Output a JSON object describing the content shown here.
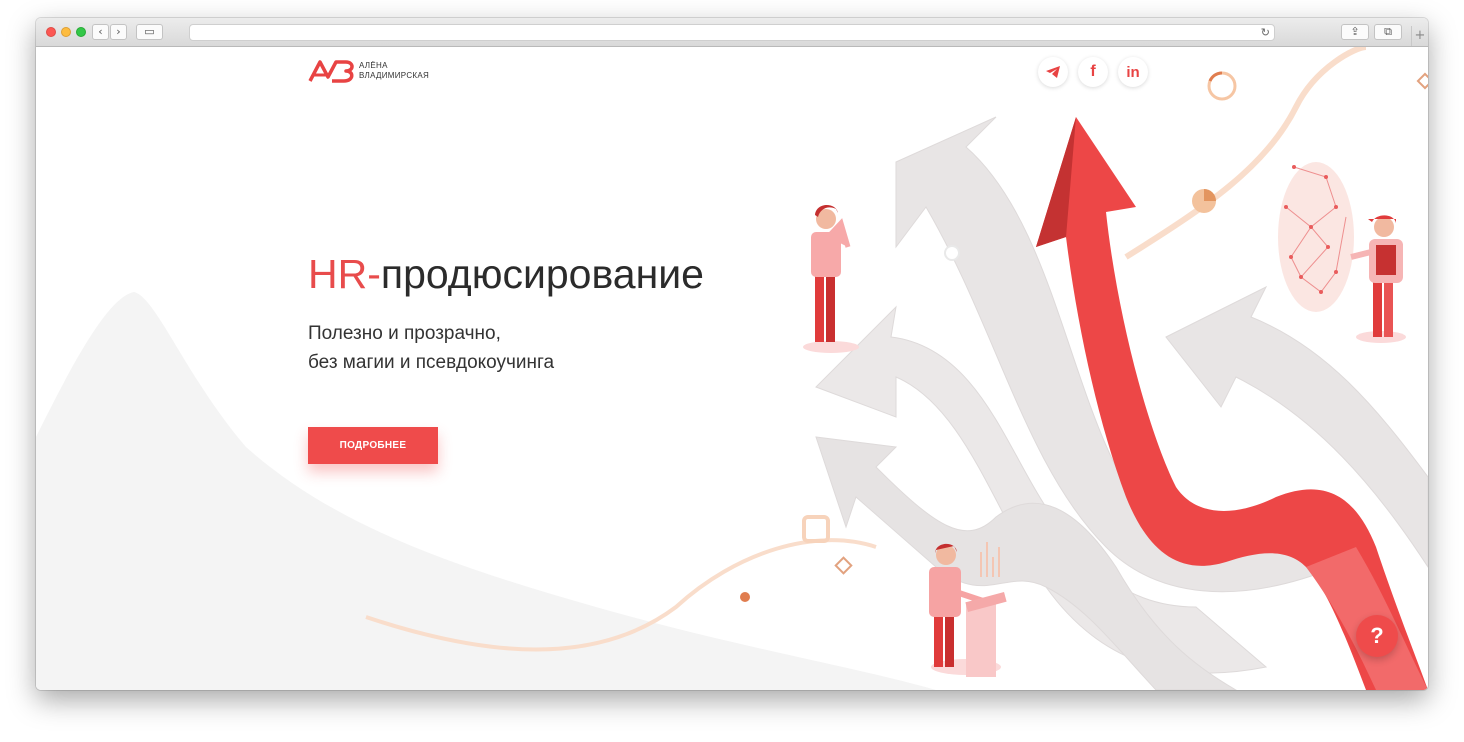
{
  "browser": {
    "back_label": "‹",
    "forward_label": "›",
    "sidebar_label": "▭",
    "share_label": "⇪",
    "tabs_label": "⧉",
    "reload_label": "↻",
    "new_tab_label": "+"
  },
  "site": {
    "logo_first_name": "АЛЁНА",
    "logo_last_name": "ВЛАДИМИРСКАЯ",
    "logo_monogram": "AB"
  },
  "social": [
    {
      "icon": "telegram-icon",
      "label": "➤"
    },
    {
      "icon": "facebook-icon",
      "label": "f"
    },
    {
      "icon": "linkedin-icon",
      "label": "in"
    }
  ],
  "hero": {
    "title_accent": "HR-",
    "title_rest": "продюсирование",
    "subtitle_line1": "Полезно и прозрачно,",
    "subtitle_line2": "без магии и псевдокоучинга",
    "button_label": "ПОДРОБНЕЕ"
  },
  "help_label": "?",
  "colors": {
    "accent": "#ef4b4b",
    "title_text": "#2b2b2b",
    "arrow_gray": "#e4e1e1",
    "peach": "#f8d4bb"
  }
}
